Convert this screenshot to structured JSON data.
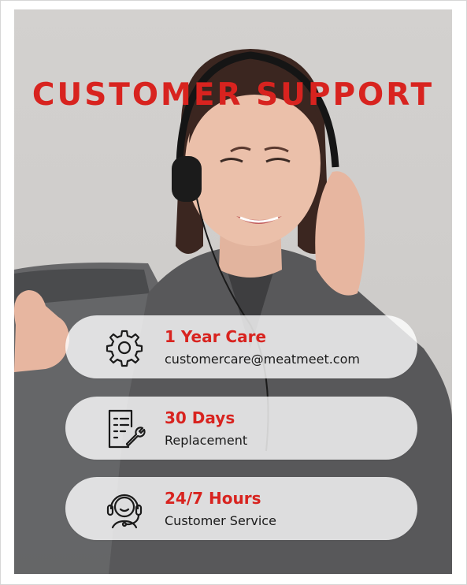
{
  "headline": "CUSTOMER SUPPORT",
  "features": [
    {
      "icon": "gear-icon",
      "title": "1 Year Care",
      "subtitle": "customercare@meatmeet.com"
    },
    {
      "icon": "document-wrench-icon",
      "title": "30 Days",
      "subtitle": "Replacement"
    },
    {
      "icon": "headset-agent-icon",
      "title": "24/7 Hours",
      "subtitle": "Customer Service"
    }
  ],
  "colors": {
    "accent": "#d8231f",
    "text": "#1a1a1a",
    "card": "#ffffff"
  }
}
